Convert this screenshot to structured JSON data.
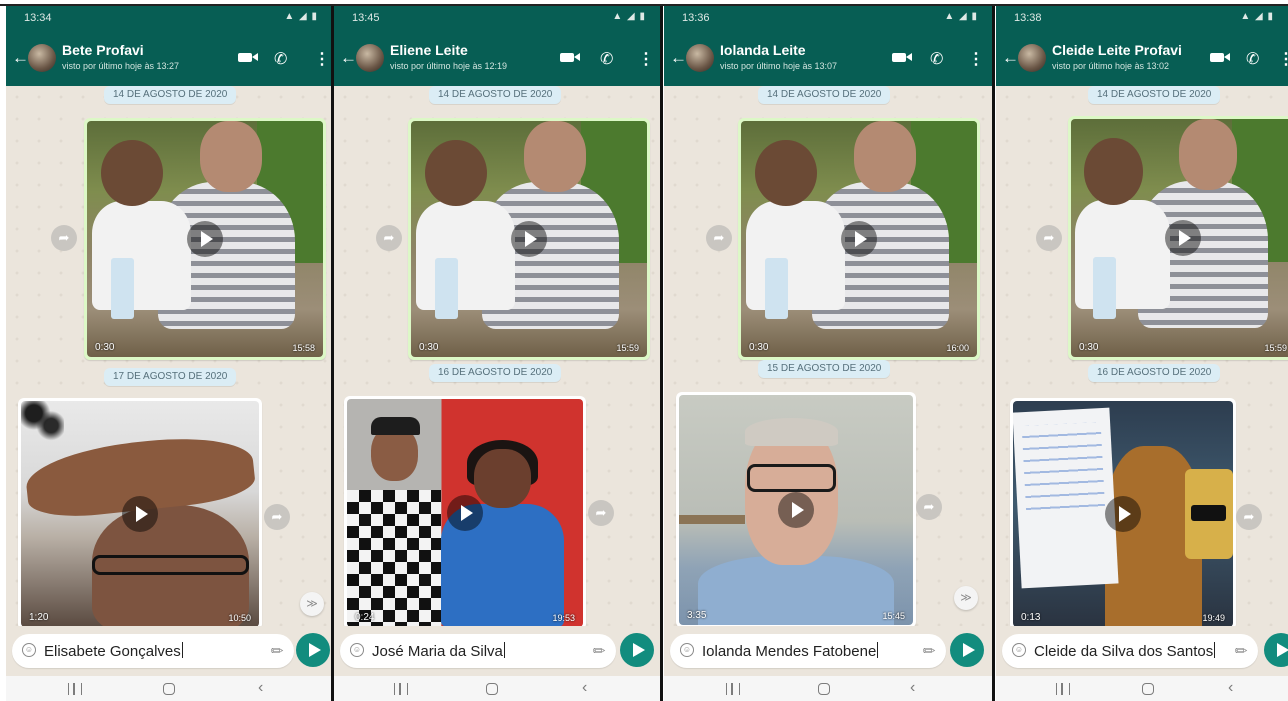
{
  "phones": [
    {
      "status_time": "13:34",
      "contact_name": "Bete Profavi",
      "last_seen": "visto por último hoje às 13:27",
      "dates": [
        "14 DE AGOSTO DE 2020",
        "17 DE AGOSTO DE 2020"
      ],
      "video1": {
        "duration": "0:30",
        "time": "15:58"
      },
      "video2": {
        "duration": "1:20",
        "time": "10:50"
      },
      "input_text": "Elisabete Gonçalves"
    },
    {
      "status_time": "13:45",
      "contact_name": "Eliene Leite",
      "last_seen": "visto por último hoje às 12:19",
      "dates": [
        "14 DE AGOSTO DE 2020",
        "16 DE AGOSTO DE 2020"
      ],
      "video1": {
        "duration": "0:30",
        "time": "15:59"
      },
      "video2": {
        "duration": "0:24",
        "time": "19:53"
      },
      "input_text": "José Maria da Silva"
    },
    {
      "status_time": "13:36",
      "contact_name": "Iolanda Leite",
      "last_seen": "visto por último hoje às 13:07",
      "dates": [
        "14 DE AGOSTO DE 2020",
        "15 DE AGOSTO DE 2020"
      ],
      "video1": {
        "duration": "0:30",
        "time": "16:00"
      },
      "video2": {
        "duration": "3:35",
        "time": "15:45"
      },
      "input_text": "Iolanda Mendes Fatobene"
    },
    {
      "status_time": "13:38",
      "contact_name": "Cleide Leite Profavi",
      "last_seen": "visto por último hoje às 13:02",
      "dates": [
        "14 DE AGOSTO DE 2020",
        "16 DE AGOSTO DE 2020"
      ],
      "video1": {
        "duration": "0:30",
        "time": "15:59"
      },
      "video2": {
        "duration": "0:13",
        "time": "19:49"
      },
      "input_text": "Cleide da Silva dos Santos"
    }
  ],
  "colors": {
    "header": "#075e54",
    "chat_bg": "#ebe5dc",
    "send": "#128c7e",
    "date_chip": "#dbedf5"
  },
  "icons": [
    "back-arrow-icon",
    "video-call-icon",
    "voice-call-icon",
    "menu-icon",
    "play-icon",
    "share-icon",
    "emoji-icon",
    "attach-icon",
    "send-icon",
    "scroll-down-icon",
    "nav-recent-icon",
    "nav-home-icon",
    "nav-back-icon"
  ]
}
